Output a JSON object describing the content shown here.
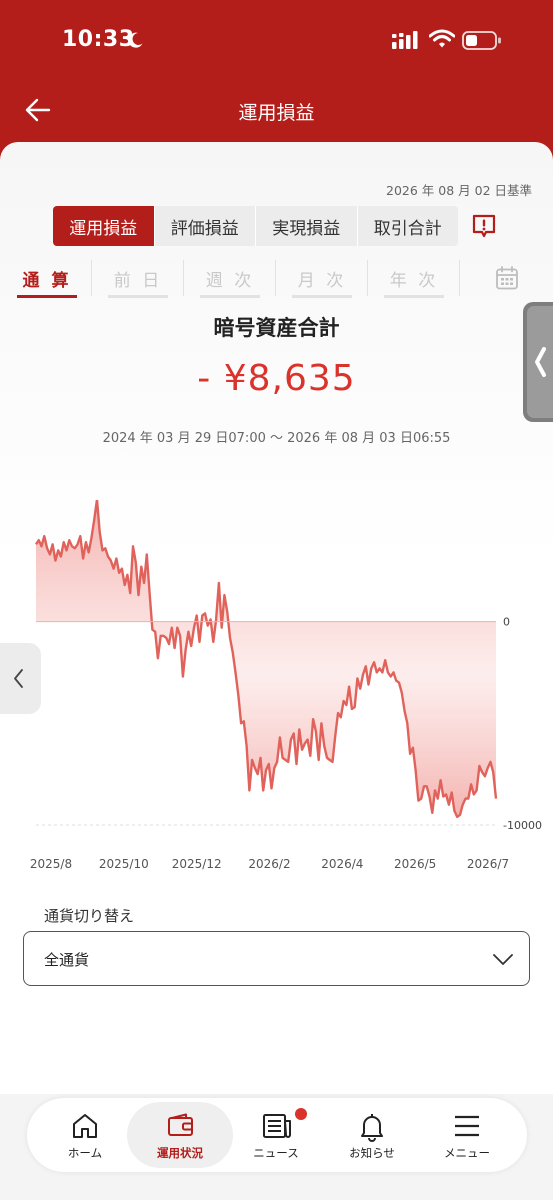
{
  "status_bar": {
    "time": "10:33"
  },
  "header": {
    "title": "運用損益"
  },
  "base_date": "2026 年 08 月 02 日基準",
  "segment_tabs": [
    {
      "label": "運用損益",
      "active": true
    },
    {
      "label": "評価損益",
      "active": false
    },
    {
      "label": "実現損益",
      "active": false
    },
    {
      "label": "取引合計",
      "active": false
    }
  ],
  "period_tabs": [
    {
      "label": "通 算",
      "active": true
    },
    {
      "label": "前 日",
      "active": false
    },
    {
      "label": "週 次",
      "active": false
    },
    {
      "label": "月 次",
      "active": false
    },
    {
      "label": "年 次",
      "active": false
    }
  ],
  "asset": {
    "title": "暗号資産合計",
    "value": "- ¥8,635",
    "date_range": "2024 年 03 月 29 日07:00 ～ 2026 年 08 月 03 日06:55"
  },
  "chart_data": {
    "type": "area",
    "x_tick_labels": [
      "2025/8",
      "2025/10",
      "2025/12",
      "2026/2",
      "2026/4",
      "2026/5",
      "2026/7"
    ],
    "y_tick_labels": [
      "0",
      "-10000"
    ],
    "ylim": [
      -10000,
      4600
    ],
    "line_color": "#e0625b",
    "fill_color": "#f5b7b3",
    "series": [
      {
        "values": [
          3800,
          4000,
          3700,
          4200,
          3600,
          3300,
          3800,
          3000,
          3500,
          3200,
          3900,
          3500,
          4000,
          3700,
          3600,
          3800,
          4200,
          3100,
          3900,
          3400,
          4100,
          5000,
          6000,
          4400,
          3500,
          3600,
          3200,
          3000,
          2600,
          3100,
          2400,
          2600,
          1800,
          2300,
          1400,
          3700,
          2900,
          1300,
          2700,
          1900,
          3300,
          1400,
          -400,
          -500,
          -1800,
          -700,
          -700,
          -800,
          -1100,
          -300,
          -1300,
          -300,
          -700,
          -2700,
          -1400,
          -500,
          -1200,
          -300,
          300,
          -1000,
          300,
          400,
          -200,
          100,
          -1000,
          100,
          1900,
          -300,
          1300,
          500,
          -800,
          -1500,
          -2500,
          -3600,
          -5000,
          -4900,
          -6100,
          -8300,
          -6800,
          -7200,
          -7500,
          -6700,
          -8300,
          -7300,
          -7000,
          -8200,
          -7200,
          -6900,
          -5700,
          -6700,
          -6800,
          -6900,
          -5800,
          -5500,
          -7000,
          -5300,
          -6300,
          -6000,
          -5800,
          -6600,
          -4800,
          -5400,
          -6800,
          -5000,
          -6100,
          -6700,
          -6800,
          -6900,
          -5600,
          -4500,
          -4700,
          -3900,
          -4100,
          -3200,
          -4300,
          -4200,
          -2800,
          -3300,
          -2600,
          -2200,
          -3100,
          -2300,
          -2000,
          -2500,
          -2300,
          -2500,
          -1900,
          -2500,
          -2700,
          -2500,
          -2900,
          -3000,
          -3500,
          -4400,
          -5000,
          -6500,
          -6200,
          -7300,
          -8800,
          -8700,
          -8100,
          -8100,
          -8600,
          -9400,
          -8300,
          -8700,
          -7800,
          -8600,
          -8500,
          -9000,
          -8400,
          -9300,
          -9600,
          -9500,
          -9000,
          -8700,
          -8700,
          -8000,
          -8500,
          -8300,
          -7100,
          -7400,
          -7600,
          -7200,
          -6900,
          -7400,
          -8700
        ]
      }
    ],
    "grid": false,
    "legend": "none"
  },
  "currency": {
    "label": "通貨切り替え",
    "selected": "全通貨"
  },
  "tabbar": [
    {
      "label": "ホーム",
      "icon": "home-icon",
      "active": false
    },
    {
      "label": "運用状況",
      "icon": "wallet-icon",
      "active": true
    },
    {
      "label": "ニュース",
      "icon": "news-icon",
      "active": false,
      "badge": true
    },
    {
      "label": "お知らせ",
      "icon": "bell-icon",
      "active": false
    },
    {
      "label": "メニュー",
      "icon": "menu-icon",
      "active": false
    }
  ],
  "colors": {
    "brand_red": "#b31e1a",
    "value_red": "#d9332b",
    "chart_line": "#e0625b"
  }
}
